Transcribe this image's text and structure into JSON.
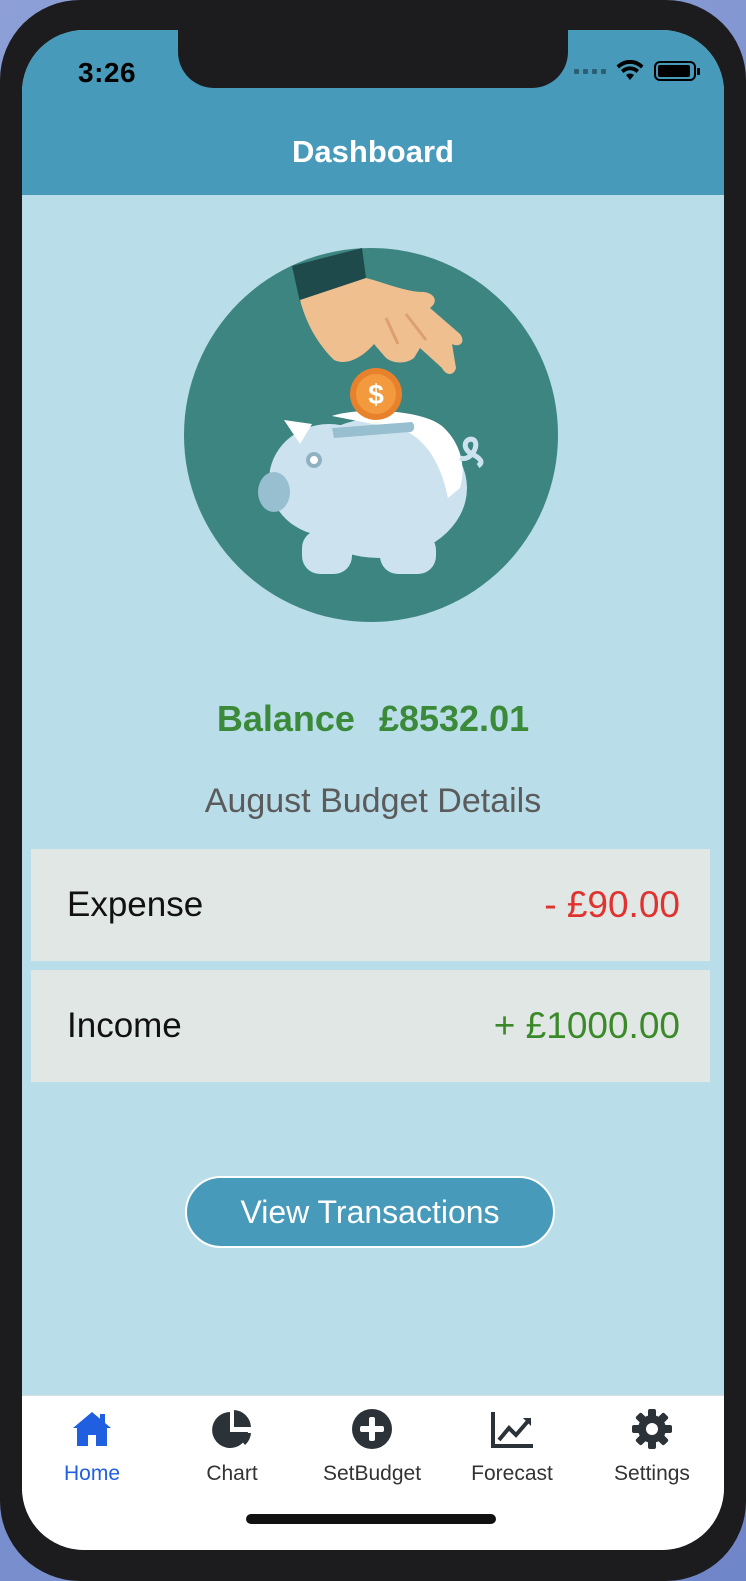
{
  "status_bar": {
    "time": "3:26"
  },
  "header": {
    "title": "Dashboard"
  },
  "balance": {
    "label": "Balance",
    "amount": "£8532.01"
  },
  "budget": {
    "title": "August Budget Details",
    "expense": {
      "label": "Expense",
      "value": "- £90.00"
    },
    "income": {
      "label": "Income",
      "value": "+ £1000.00"
    }
  },
  "actions": {
    "view_transactions": "View Transactions"
  },
  "tabs": [
    {
      "label": "Home",
      "icon": "home-icon",
      "active": true
    },
    {
      "label": "Chart",
      "icon": "pie-chart-icon",
      "active": false
    },
    {
      "label": "SetBudget",
      "icon": "plus-circle-icon",
      "active": false
    },
    {
      "label": "Forecast",
      "icon": "line-chart-icon",
      "active": false
    },
    {
      "label": "Settings",
      "icon": "gear-icon",
      "active": false
    }
  ],
  "colors": {
    "header": "#479aba",
    "background": "#b9dde9",
    "balance": "#3b8a3a",
    "expense": "#e0322e",
    "income": "#3b8a2a",
    "active_tab": "#1f5fe0"
  }
}
